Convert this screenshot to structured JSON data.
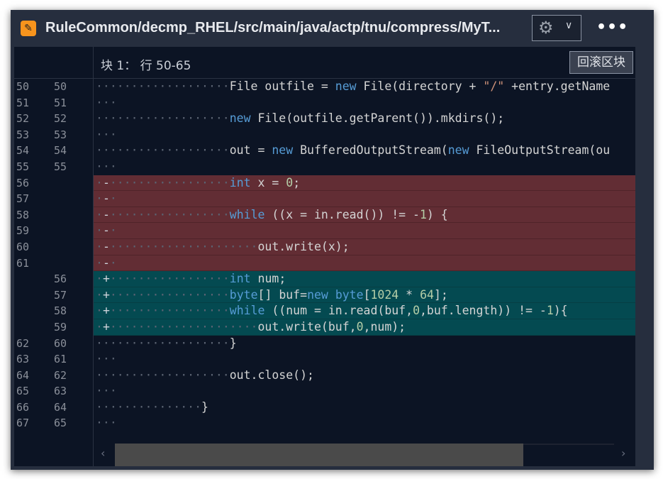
{
  "window": {
    "title": "RuleCommon/decmp_RHEL/src/main/java/actp/tnu/compress/MyT...",
    "file_icon": "pencil-icon",
    "gear_icon": "gear-icon",
    "menu_icon": "more-icon",
    "more_label": "•••"
  },
  "hunk": {
    "label": "块 1： 行 50-65",
    "revert_label": "回滚区块"
  },
  "colors": {
    "deleted_bg": "#622d34",
    "added_bg": "#044a51",
    "keyword": "#569cd6",
    "number": "#b5cea8",
    "string": "#ce9178",
    "background": "#0c1424"
  },
  "lines": [
    {
      "old": "50",
      "new": "50",
      "type": "ctx",
      "tokens": [
        [
          "                   ",
          "ws"
        ],
        [
          "File outfile = ",
          ""
        ],
        [
          "new",
          "kw"
        ],
        [
          " File(directory + ",
          ""
        ],
        [
          "\"/\"",
          "str"
        ],
        [
          " +entry.getName",
          ""
        ]
      ]
    },
    {
      "old": "51",
      "new": "51",
      "type": "ctx",
      "tokens": [
        [
          "   ",
          "ws"
        ]
      ]
    },
    {
      "old": "52",
      "new": "52",
      "type": "ctx",
      "tokens": [
        [
          "                   ",
          "ws"
        ],
        [
          "new",
          "kw"
        ],
        [
          " File(outfile.getParent()).mkdirs();",
          ""
        ]
      ]
    },
    {
      "old": "53",
      "new": "53",
      "type": "ctx",
      "tokens": [
        [
          "   ",
          "ws"
        ]
      ]
    },
    {
      "old": "54",
      "new": "54",
      "type": "ctx",
      "tokens": [
        [
          "                   ",
          "ws"
        ],
        [
          "out = ",
          ""
        ],
        [
          "new",
          "kw"
        ],
        [
          " BufferedOutputStream(",
          ""
        ],
        [
          "new",
          "kw"
        ],
        [
          " FileOutputStream(ou",
          ""
        ]
      ]
    },
    {
      "old": "55",
      "new": "55",
      "type": "ctx",
      "tokens": [
        [
          "   ",
          "ws"
        ]
      ]
    },
    {
      "old": "56",
      "new": "",
      "type": "del",
      "tokens": [
        [
          " ",
          "ws"
        ],
        [
          "-",
          "mark"
        ],
        [
          "                 ",
          "ws"
        ],
        [
          "int",
          "kw"
        ],
        [
          " x = ",
          ""
        ],
        [
          "0",
          "num"
        ],
        [
          ";",
          ""
        ]
      ]
    },
    {
      "old": "57",
      "new": "",
      "type": "del",
      "tokens": [
        [
          " ",
          "ws"
        ],
        [
          "-",
          "mark"
        ],
        [
          " ",
          "ws"
        ]
      ]
    },
    {
      "old": "58",
      "new": "",
      "type": "del",
      "tokens": [
        [
          " ",
          "ws"
        ],
        [
          "-",
          "mark"
        ],
        [
          "                 ",
          "ws"
        ],
        [
          "while",
          "kw"
        ],
        [
          " ((x = in.read()) != -",
          ""
        ],
        [
          "1",
          "num"
        ],
        [
          ") {",
          ""
        ]
      ]
    },
    {
      "old": "59",
      "new": "",
      "type": "del",
      "tokens": [
        [
          " ",
          "ws"
        ],
        [
          "-",
          "mark"
        ],
        [
          " ",
          "ws"
        ]
      ]
    },
    {
      "old": "60",
      "new": "",
      "type": "del",
      "tokens": [
        [
          " ",
          "ws"
        ],
        [
          "-",
          "mark"
        ],
        [
          "                     ",
          "ws"
        ],
        [
          "out.write(x);",
          ""
        ]
      ]
    },
    {
      "old": "61",
      "new": "",
      "type": "del",
      "tokens": [
        [
          " ",
          "ws"
        ],
        [
          "-",
          "mark"
        ],
        [
          " ",
          "ws"
        ]
      ]
    },
    {
      "old": "",
      "new": "56",
      "type": "add",
      "tokens": [
        [
          " ",
          "ws"
        ],
        [
          "+",
          "mark"
        ],
        [
          "                 ",
          "ws"
        ],
        [
          "int",
          "kw"
        ],
        [
          " num;",
          ""
        ]
      ]
    },
    {
      "old": "",
      "new": "57",
      "type": "add",
      "tokens": [
        [
          " ",
          "ws"
        ],
        [
          "+",
          "mark"
        ],
        [
          "                 ",
          "ws"
        ],
        [
          "byte",
          "kw"
        ],
        [
          "[] buf=",
          ""
        ],
        [
          "new",
          "kw"
        ],
        [
          " ",
          ""
        ],
        [
          "byte",
          "kw"
        ],
        [
          "[",
          ""
        ],
        [
          "1024",
          "num"
        ],
        [
          " * ",
          ""
        ],
        [
          "64",
          "num"
        ],
        [
          "];",
          ""
        ]
      ]
    },
    {
      "old": "",
      "new": "58",
      "type": "add",
      "tokens": [
        [
          " ",
          "ws"
        ],
        [
          "+",
          "mark"
        ],
        [
          "                 ",
          "ws"
        ],
        [
          "while",
          "kw"
        ],
        [
          " ((num = in.read(buf,",
          ""
        ],
        [
          "0",
          "num"
        ],
        [
          ",buf.length)) != -",
          ""
        ],
        [
          "1",
          "num"
        ],
        [
          "){",
          ""
        ]
      ]
    },
    {
      "old": "",
      "new": "59",
      "type": "add",
      "tokens": [
        [
          " ",
          "ws"
        ],
        [
          "+",
          "mark"
        ],
        [
          "                     ",
          "ws"
        ],
        [
          "out.write(buf,",
          ""
        ],
        [
          "0",
          "num"
        ],
        [
          ",num);",
          ""
        ]
      ]
    },
    {
      "old": "62",
      "new": "60",
      "type": "ctx",
      "tokens": [
        [
          "                   ",
          "ws"
        ],
        [
          "}",
          ""
        ]
      ]
    },
    {
      "old": "63",
      "new": "61",
      "type": "ctx",
      "tokens": [
        [
          "   ",
          "ws"
        ]
      ]
    },
    {
      "old": "64",
      "new": "62",
      "type": "ctx",
      "tokens": [
        [
          "                   ",
          "ws"
        ],
        [
          "out.close();",
          ""
        ]
      ]
    },
    {
      "old": "65",
      "new": "63",
      "type": "ctx",
      "tokens": [
        [
          "   ",
          "ws"
        ]
      ]
    },
    {
      "old": "66",
      "new": "64",
      "type": "ctx",
      "tokens": [
        [
          "               ",
          "ws"
        ],
        [
          "}",
          ""
        ]
      ]
    },
    {
      "old": "67",
      "new": "65",
      "type": "ctx",
      "tokens": [
        [
          "   ",
          "ws"
        ]
      ]
    }
  ],
  "scrollbar": {
    "left_icon": "chevron-left-icon",
    "right_icon": "chevron-right-icon",
    "left_glyph": "‹",
    "right_glyph": "›",
    "position_percent": 0
  }
}
